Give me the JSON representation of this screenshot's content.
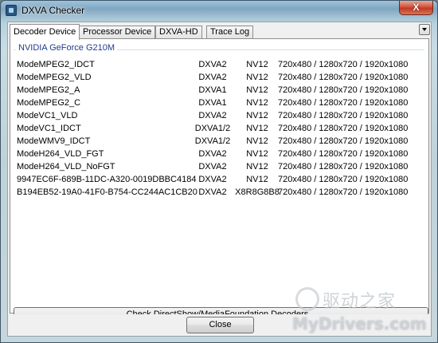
{
  "window": {
    "title": "DXVA Checker",
    "close_glyph": "X"
  },
  "tabs": [
    {
      "label": "Decoder Device",
      "active": true
    },
    {
      "label": "Processor Device",
      "active": false
    },
    {
      "label": "DXVA-HD",
      "active": false
    },
    {
      "label": "Trace Log",
      "active": false
    }
  ],
  "tab_menu_icon": "dropdown-arrow-icon",
  "group": {
    "title": "NVIDIA GeForce G210M"
  },
  "decoders": [
    {
      "name": "ModeMPEG2_IDCT",
      "api": "DXVA2",
      "format": "NV12",
      "resolutions": "720x480 / 1280x720 / 1920x1080"
    },
    {
      "name": "ModeMPEG2_VLD",
      "api": "DXVA2",
      "format": "NV12",
      "resolutions": "720x480 / 1280x720 / 1920x1080"
    },
    {
      "name": "ModeMPEG2_A",
      "api": "DXVA1",
      "format": "NV12",
      "resolutions": "720x480 / 1280x720 / 1920x1080"
    },
    {
      "name": "ModeMPEG2_C",
      "api": "DXVA1",
      "format": "NV12",
      "resolutions": "720x480 / 1280x720 / 1920x1080"
    },
    {
      "name": "ModeVC1_VLD",
      "api": "DXVA2",
      "format": "NV12",
      "resolutions": "720x480 / 1280x720 / 1920x1080"
    },
    {
      "name": "ModeVC1_IDCT",
      "api": "DXVA1/2",
      "format": "NV12",
      "resolutions": "720x480 / 1280x720 / 1920x1080"
    },
    {
      "name": "ModeWMV9_IDCT",
      "api": "DXVA1/2",
      "format": "NV12",
      "resolutions": "720x480 / 1280x720 / 1920x1080"
    },
    {
      "name": "ModeH264_VLD_FGT",
      "api": "DXVA2",
      "format": "NV12",
      "resolutions": "720x480 / 1280x720 / 1920x1080"
    },
    {
      "name": "ModeH264_VLD_NoFGT",
      "api": "DXVA2",
      "format": "NV12",
      "resolutions": "720x480 / 1280x720 / 1920x1080"
    },
    {
      "name": "9947EC6F-689B-11DC-A320-0019DBBC4184",
      "api": "DXVA2",
      "format": "NV12",
      "resolutions": "720x480 / 1280x720 / 1920x1080"
    },
    {
      "name": "B194EB52-19A0-41F0-B754-CC244AC1CB20",
      "api": "DXVA2",
      "format": "X8R8G8B8",
      "resolutions": "720x480 / 1280x720 / 1920x1080"
    }
  ],
  "buttons": {
    "check": "Check DirectShow/MediaFoundation Decoders...",
    "close": "Close"
  },
  "watermark": {
    "cn": "驱动之家",
    "en": "MyDrivers.com"
  }
}
